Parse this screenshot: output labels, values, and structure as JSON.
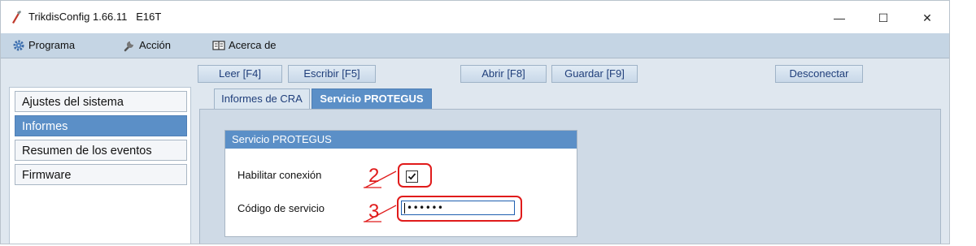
{
  "window": {
    "title": "TrikdisConfig 1.66.11   E16T",
    "controls": {
      "minimize": "—",
      "maximize": "☐",
      "close": "✕"
    }
  },
  "menu": {
    "items": [
      {
        "label": "Programa",
        "icon": "gear-icon"
      },
      {
        "label": "Acción",
        "icon": "wrench-icon"
      },
      {
        "label": "Acerca de",
        "icon": "book-icon"
      }
    ]
  },
  "toolbar": {
    "read_label": "Leer [F4]",
    "write_label": "Escribir [F5]",
    "open_label": "Abrir [F8]",
    "save_label": "Guardar [F9]",
    "disconnect_label": "Desconectar"
  },
  "sidebar": {
    "items": [
      {
        "label": "Ajustes del sistema",
        "active": false
      },
      {
        "label": "Informes",
        "active": true
      },
      {
        "label": "Resumen de los eventos",
        "active": false
      },
      {
        "label": "Firmware",
        "active": false
      }
    ]
  },
  "tabs": [
    {
      "label": "Informes de CRA",
      "active": false
    },
    {
      "label": "Servicio PROTEGUS",
      "active": true
    }
  ],
  "group": {
    "title": "Servicio PROTEGUS",
    "enable_label": "Habilitar conexión",
    "enable_checked": true,
    "code_label": "Código de servicio",
    "code_value": "••••••"
  },
  "annotations": [
    {
      "number": "2",
      "target": "enable-checkbox"
    },
    {
      "number": "3",
      "target": "service-code-input"
    }
  ],
  "colors": {
    "menubar": "#c5d5e4",
    "accent_blue": "#5b8fc7",
    "toolbar_text": "#1f3e7a",
    "annotation_red": "#e01b1b"
  }
}
